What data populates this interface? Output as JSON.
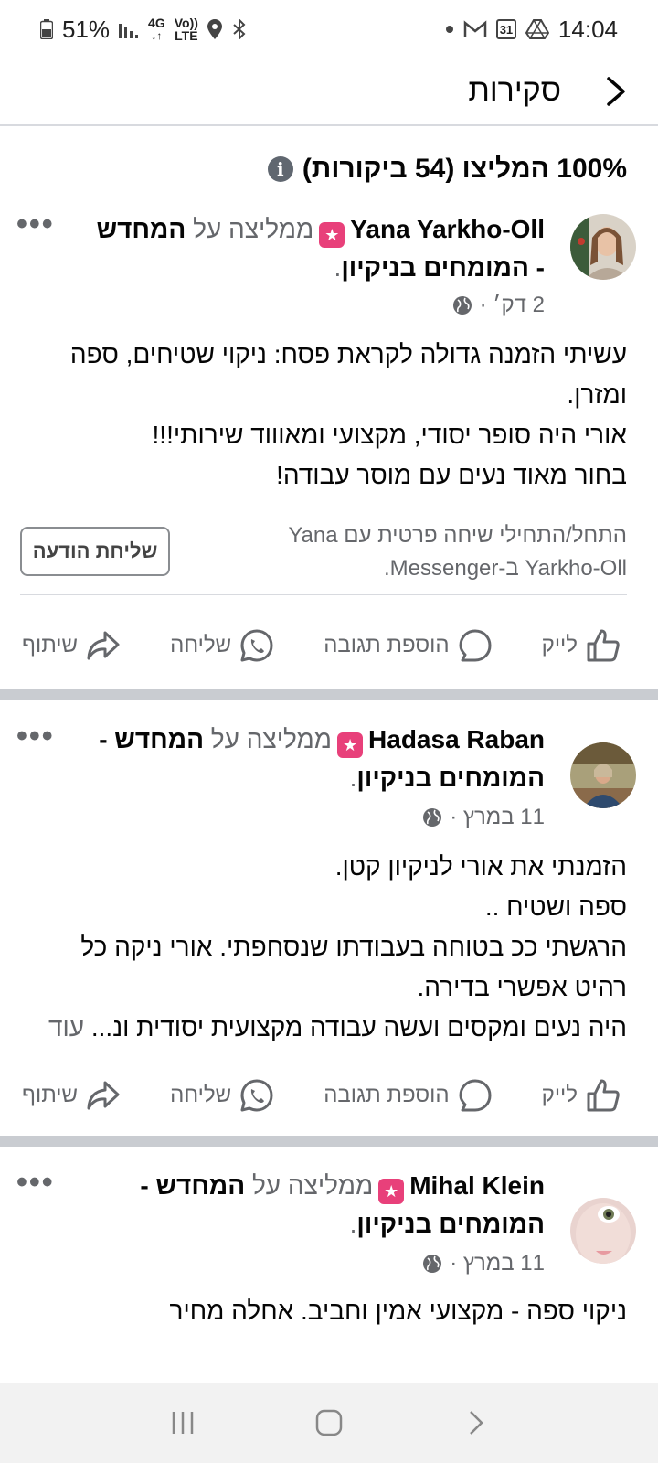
{
  "status_bar": {
    "battery": "51%",
    "network": "4G",
    "volte_top": "Vo))",
    "volte_bottom": "LTE",
    "calendar_day": "31",
    "time": "14:04",
    "left_icons": [
      "battery-icon",
      "signal-icon",
      "data-icon",
      "volte-icon",
      "location-icon",
      "bluetooth-icon"
    ],
    "right_icons": [
      "dot-icon",
      "gmail-icon",
      "calendar-icon",
      "drive-icon"
    ]
  },
  "header": {
    "title": "סקירות"
  },
  "summary": {
    "text": "100% המליצו (54 ביקורות)"
  },
  "reviews": [
    {
      "name": "Yana Yarkho-Oll",
      "recommends": "ממליצה על",
      "page": "המחדש - המומחים בניקיון",
      "time": "2 דק׳ ·",
      "body": [
        "עשיתי הזמנה גדולה לקראת פסח: ניקוי שטיחים, ספה ומזרן.",
        "אורי היה סופר יסודי, מקצועי ומאוווד שירותי!!!",
        "בחור מאוד נעים עם מוסר עבודה!"
      ],
      "message_prompt": "התחל/התחילי שיחה פרטית עם Yana Yarkho-Oll ב-Messenger.",
      "message_button": "שליחת הודעה"
    },
    {
      "name": "Hadasa Raban",
      "recommends": "ממליצה על",
      "page": "המחדש - המומחים בניקיון",
      "time": "11 במרץ ·",
      "body": [
        "הזמנתי את אורי לניקיון קטן.",
        "ספה ושטיח ..",
        "הרגשתי ככ בטוחה בעבודתו שנסחפתי.  אורי ניקה כל רהיט אפשרי בדירה.",
        "היה נעים ומקסים ועשה עבודה מקצועית יסודית ונ..."
      ],
      "more": "עוד"
    },
    {
      "name": "Mihal Klein",
      "recommends": "ממליצה על",
      "page": "המחדש - המומחים בניקיון",
      "time": "11 במרץ ·",
      "body": [
        "ניקוי ספה - מקצועי אמין וחביב. אחלה מחיר"
      ]
    }
  ],
  "actions": {
    "like": "לייק",
    "comment": "הוספת תגובה",
    "send": "שליחה",
    "share": "שיתוף"
  },
  "colors": {
    "secondary_text": "#65676b",
    "badge": "#e8407a",
    "separator": "#c9ccd1"
  }
}
